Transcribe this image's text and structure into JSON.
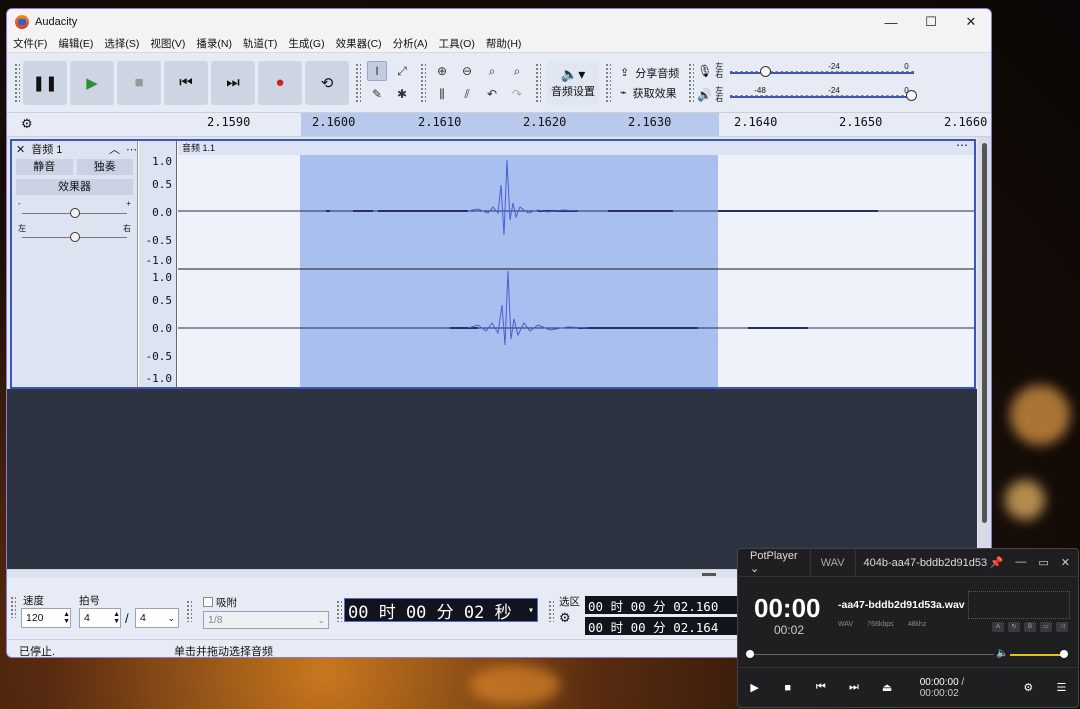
{
  "app": {
    "title": "Audacity",
    "window_controls": [
      "—",
      "☐",
      "✕"
    ]
  },
  "menu": [
    "文件(F)",
    "编辑(E)",
    "选择(S)",
    "视图(V)",
    "播录(N)",
    "轨道(T)",
    "生成(G)",
    "效果器(C)",
    "分析(A)",
    "工具(O)",
    "帮助(H)"
  ],
  "toolbar": {
    "audio_settings_label": "音频设置",
    "share_label": "分享音频",
    "get_effects_label": "获取效果",
    "meter_lr_top": "左\n右",
    "meter_rec_marks": [
      "-24",
      "0"
    ],
    "meter_play_marks": [
      "-48",
      "-24",
      "0"
    ]
  },
  "ruler": {
    "ticks": [
      "2.1590",
      "2.1600",
      "2.1610",
      "2.1620",
      "2.1630",
      "2.1640",
      "2.1650",
      "2.1660"
    ]
  },
  "track": {
    "name": "音频 1",
    "mute": "静音",
    "solo": "独奏",
    "effects": "效果器",
    "gain_min": "-",
    "gain_max": "+",
    "pan_min": "左",
    "pan_max": "右",
    "clip_name": "音频 1.1",
    "scale_top": [
      "1.0",
      "0.5",
      "0.0",
      "-0.5",
      "-1.0"
    ],
    "scale_bottom": [
      "1.0",
      "0.5",
      "0.0",
      "-0.5",
      "-1.0"
    ]
  },
  "bottom": {
    "rate_label": "速度",
    "rate_value": "120",
    "meter_label": "拍号",
    "meter_num": "4",
    "meter_den": "4",
    "snap_label": "吸附",
    "snap_value": "1/8",
    "time_display": "00 时 00 分 02 秒",
    "selection_label": "选区",
    "sel_start": "00 时 00 分 02.160",
    "sel_end": "00 时 00 分 02.164"
  },
  "status": {
    "state": "已停止.",
    "hint": "单击并拖动选择音频"
  },
  "potplayer": {
    "brand": "PotPlayer",
    "format": "WAV",
    "title_file": "404b-aa47-bddb2d91d53",
    "big_time": "00:00",
    "sub_time": "00:02",
    "file_name": "-aa47-bddb2d91d53a.wav",
    "meta": [
      "WAV",
      "768kbps",
      "48khz"
    ],
    "current_time": "00:00:00",
    "time_sep": "/",
    "total_time": "00:00:02"
  }
}
